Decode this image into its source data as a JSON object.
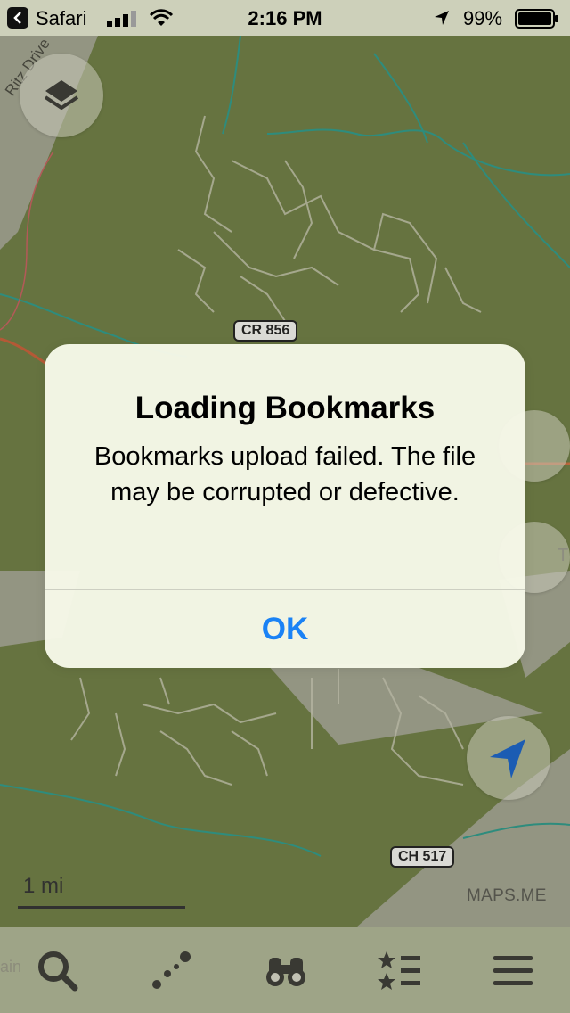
{
  "status_bar": {
    "back_app": "Safari",
    "time": "2:16 PM",
    "battery": "99%"
  },
  "map": {
    "road_label": "Ritz Drive",
    "road_shields": [
      "CR 856",
      "CH 517"
    ],
    "edge_letter": "T",
    "scale": "1 mi",
    "watermark": "MAPS.ME"
  },
  "toolbar": {
    "edge_label": "ain",
    "items": [
      "search-icon",
      "route-icon",
      "binoculars-icon",
      "bookmarks-icon",
      "menu-icon"
    ]
  },
  "alert": {
    "title": "Loading Bookmarks",
    "message": "Bookmarks upload failed. The file may be corrupted or defective.",
    "ok_label": "OK"
  },
  "colors": {
    "map_forest": "#6f7e45",
    "map_open": "#a8a89a",
    "alert_button": "#1a82f5",
    "nav_arrow": "#1a64c8"
  }
}
